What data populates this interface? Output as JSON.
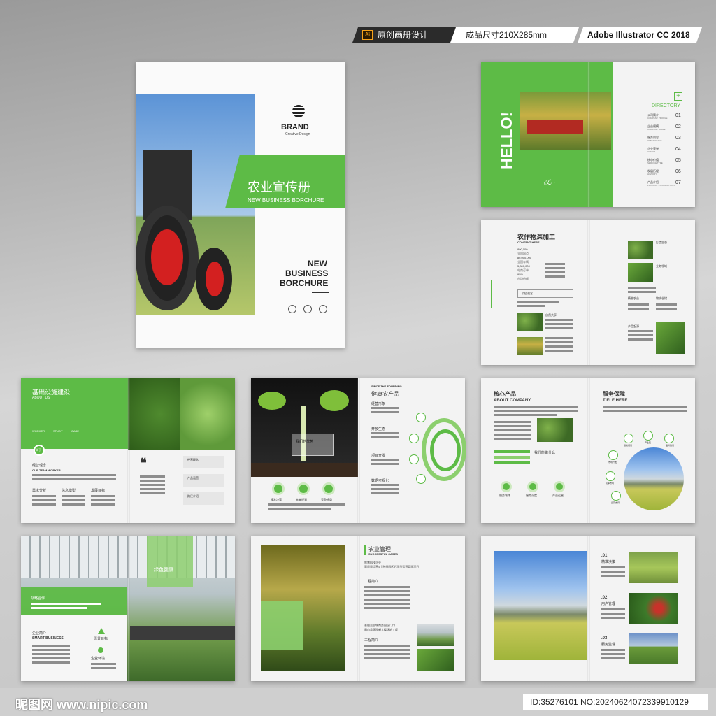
{
  "tags": {
    "ai": "Ai",
    "t1": "原创画册设计",
    "t2": "成品尺寸210X285mm",
    "t3": "Adobe Illustrator CC 2018"
  },
  "cover": {
    "brand": "BRAND",
    "brand_sub": "Creative Design",
    "title_cn": "农业宣传册",
    "title_en": "NEW BUSINESS BORCHURE",
    "big1": "NEW",
    "big2": "BUSINESS",
    "big3": "BORCHURE"
  },
  "p1": {
    "hello": "HELLO!",
    "directory": "DIRECTORY",
    "items": [
      {
        "cn": "公司简介",
        "en": "COMPANY PROFILE",
        "no": "01"
      },
      {
        "cn": "企业规模",
        "en": "COMPANY SCALE",
        "no": "02"
      },
      {
        "cn": "服务内容",
        "en": "OUR SERVICE",
        "no": "03"
      },
      {
        "cn": "企业荣誉",
        "en": "HONOR",
        "no": "04"
      },
      {
        "cn": "核心价值",
        "en": "SERVICE TYPE",
        "no": "05"
      },
      {
        "cn": "发展历程",
        "en": "HISTORY",
        "no": "06"
      },
      {
        "cn": "产品介绍",
        "en": "PRODUCT INTRODUCTION",
        "no": "07"
      }
    ]
  },
  "p2": {
    "title": "农作物深加工",
    "sub": "CONTENT HERE",
    "nums": [
      "800,000",
      "全国网点",
      "86,000,000",
      "全国车辆",
      "5,800,000",
      "电商订单",
      "95%",
      "市场份额"
    ],
    "box": "价值观念",
    "l1": "自然共享",
    "r1": "打造生态",
    "r2": "业务领域",
    "r3": "精准农业",
    "r4": "物流仓储",
    "r5": "产品起源"
  },
  "p3": {
    "title": "基础设施建设",
    "sub": "ABOUT US",
    "tabs": [
      "WORKER",
      "STUDY",
      "CASE"
    ],
    "badge": "关于",
    "t1": "经营理念",
    "t1e": "OUR TEAM WORKER",
    "c1": "需求分析",
    "c2": "信息模型",
    "c3": "发展目标",
    "r1": "经营理念",
    "r2": "产品运营",
    "r3": "路径介绍"
  },
  "p4": {
    "since": "SINCE THE FOUNDING",
    "title": "健康农产品",
    "box": "我们的优势",
    "b1": "精准决策",
    "b2": "未来规划",
    "b3": "竞争格局",
    "a1": "经营形象",
    "a2": "开放生态",
    "a3": "项目开发",
    "a4": "数据可视化"
  },
  "p5": {
    "t1": "核心产品",
    "t1e": "ABOUT COMPANY",
    "t2": "服务保障",
    "t2e": "TIELE HERE",
    "q": "我们能做什么",
    "b1": "服务领域",
    "b2": "服务深度",
    "b3": "产业运营",
    "n1": "运动规划",
    "n2": "产业链",
    "n3": "品牌策划",
    "n4": "市场开发",
    "n5": "竞争市场",
    "n6": "运营支持"
  },
  "p6": {
    "tag1": "绿色健康",
    "tag2": "战略合作",
    "t1": "企业简介",
    "t1e": "SMART BUSINESS",
    "i1": "愿景目标",
    "i2": "企业环境"
  },
  "p7": {
    "title": "农业管理",
    "sub": "SUCCESSFUL CASES",
    "h1": "智慧科技企业",
    "desc": "高质量运营4个种植园区的项目运营管理项目",
    "s1": "工程简介",
    "s2": "合肥县县城商务园区门口",
    "s3": "眉山县医院新大楼场地工程",
    "s4": "工程简介"
  },
  "p8": {
    "n1": ".01",
    "c1": "精准决策",
    "n2": ".02",
    "c2": "用户管理",
    "n3": ".03",
    "c3": "服务监督"
  },
  "watermark": {
    "left": "昵图网 www.nipic.com",
    "right": "ID:35276101 NO:20240624072339910129"
  },
  "colors": {
    "green": "#5dbb46",
    "light_green": "#8ccf6e"
  }
}
